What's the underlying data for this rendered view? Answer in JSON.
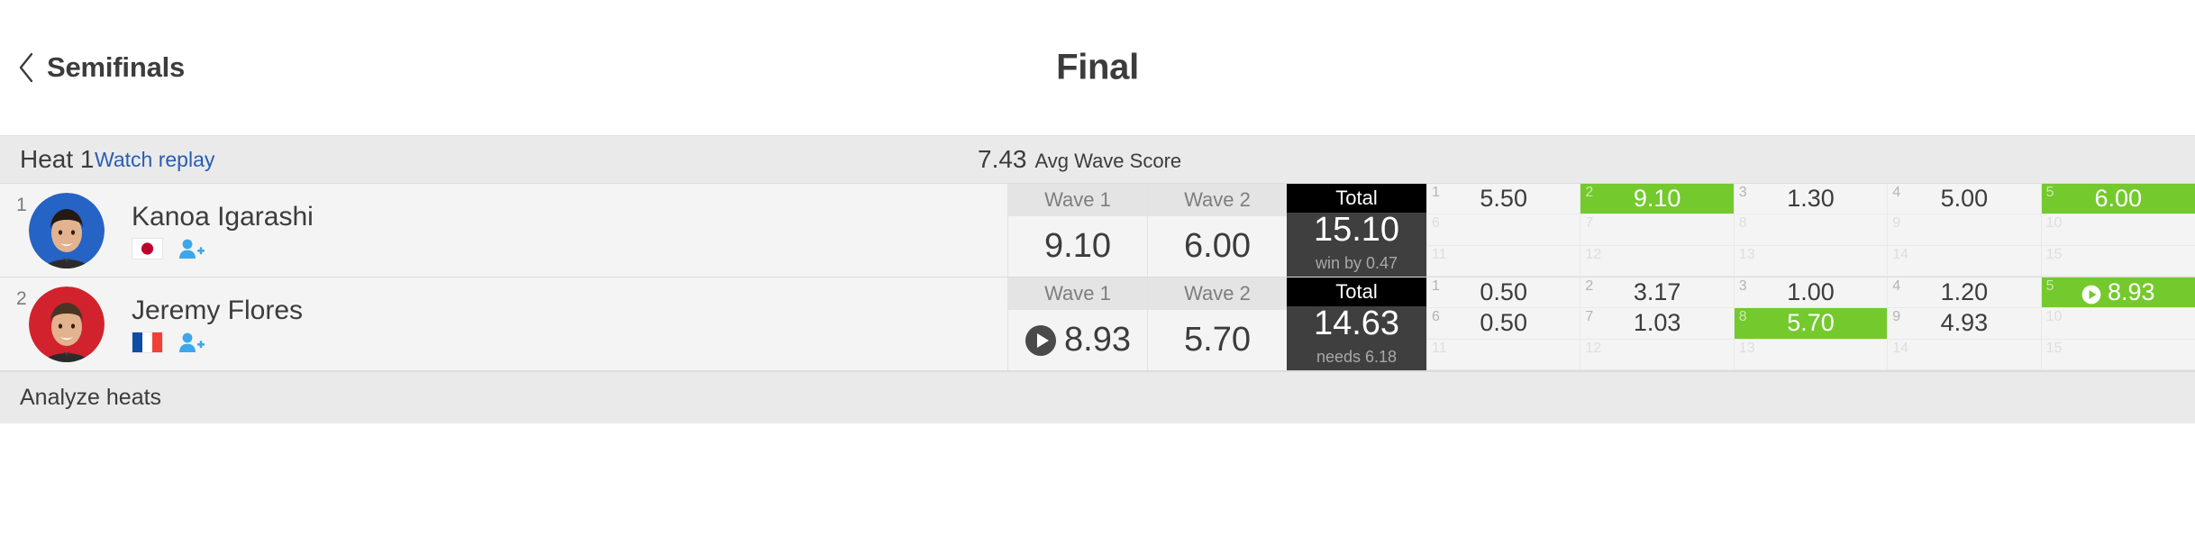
{
  "header": {
    "back_label": "Semifinals",
    "back_icon": "chevron-left-icon",
    "title": "Final"
  },
  "heat": {
    "name": "Heat 1",
    "watch_replay_label": "Watch replay",
    "avg_wave_score_value": "7.43",
    "avg_wave_score_label": "Avg Wave Score"
  },
  "columns": {
    "wave1": "Wave 1",
    "wave2": "Wave 2",
    "total": "Total"
  },
  "colors": {
    "accent_green": "#74c92d",
    "link_blue": "#2a5db0",
    "total_header": "#000000",
    "total_body": "#3f3f3f",
    "bar_bg": "#eaeaea"
  },
  "surfers": [
    {
      "rank": "1",
      "name": "Kanoa Igarashi",
      "country": "Japan",
      "flag_icon": "flag-japan-icon",
      "follow_icon": "add-person-icon",
      "avatar_bg": "#2563c4",
      "wave1": "9.10",
      "wave1_has_play": false,
      "wave2": "6.00",
      "wave2_has_play": false,
      "total": "15.10",
      "total_note": "win by 0.47",
      "waves": [
        {
          "index": "1",
          "score": "5.50",
          "highlight": false,
          "play": false
        },
        {
          "index": "2",
          "score": "9.10",
          "highlight": true,
          "play": false
        },
        {
          "index": "3",
          "score": "1.30",
          "highlight": false,
          "play": false
        },
        {
          "index": "4",
          "score": "5.00",
          "highlight": false,
          "play": false
        },
        {
          "index": "5",
          "score": "6.00",
          "highlight": true,
          "play": false
        },
        {
          "index": "6",
          "score": "",
          "highlight": false,
          "play": false
        },
        {
          "index": "7",
          "score": "",
          "highlight": false,
          "play": false
        },
        {
          "index": "8",
          "score": "",
          "highlight": false,
          "play": false
        },
        {
          "index": "9",
          "score": "",
          "highlight": false,
          "play": false
        },
        {
          "index": "10",
          "score": "",
          "highlight": false,
          "play": false
        },
        {
          "index": "11",
          "score": "",
          "highlight": false,
          "play": false
        },
        {
          "index": "12",
          "score": "",
          "highlight": false,
          "play": false
        },
        {
          "index": "13",
          "score": "",
          "highlight": false,
          "play": false
        },
        {
          "index": "14",
          "score": "",
          "highlight": false,
          "play": false
        },
        {
          "index": "15",
          "score": "",
          "highlight": false,
          "play": false
        }
      ]
    },
    {
      "rank": "2",
      "name": "Jeremy Flores",
      "country": "France",
      "flag_icon": "flag-france-icon",
      "follow_icon": "add-person-icon",
      "avatar_bg": "#d2222e",
      "wave1": "8.93",
      "wave1_has_play": true,
      "wave2": "5.70",
      "wave2_has_play": false,
      "total": "14.63",
      "total_note": "needs 6.18",
      "waves": [
        {
          "index": "1",
          "score": "0.50",
          "highlight": false,
          "play": false
        },
        {
          "index": "2",
          "score": "3.17",
          "highlight": false,
          "play": false
        },
        {
          "index": "3",
          "score": "1.00",
          "highlight": false,
          "play": false
        },
        {
          "index": "4",
          "score": "1.20",
          "highlight": false,
          "play": false
        },
        {
          "index": "5",
          "score": "8.93",
          "highlight": true,
          "play": true
        },
        {
          "index": "6",
          "score": "0.50",
          "highlight": false,
          "play": false
        },
        {
          "index": "7",
          "score": "1.03",
          "highlight": false,
          "play": false
        },
        {
          "index": "8",
          "score": "5.70",
          "highlight": true,
          "play": false
        },
        {
          "index": "9",
          "score": "4.93",
          "highlight": false,
          "play": false
        },
        {
          "index": "10",
          "score": "",
          "highlight": false,
          "play": false
        },
        {
          "index": "11",
          "score": "",
          "highlight": false,
          "play": false
        },
        {
          "index": "12",
          "score": "",
          "highlight": false,
          "play": false
        },
        {
          "index": "13",
          "score": "",
          "highlight": false,
          "play": false
        },
        {
          "index": "14",
          "score": "",
          "highlight": false,
          "play": false
        },
        {
          "index": "15",
          "score": "",
          "highlight": false,
          "play": false
        }
      ]
    }
  ],
  "footer": {
    "analyze_label": "Analyze heats"
  }
}
